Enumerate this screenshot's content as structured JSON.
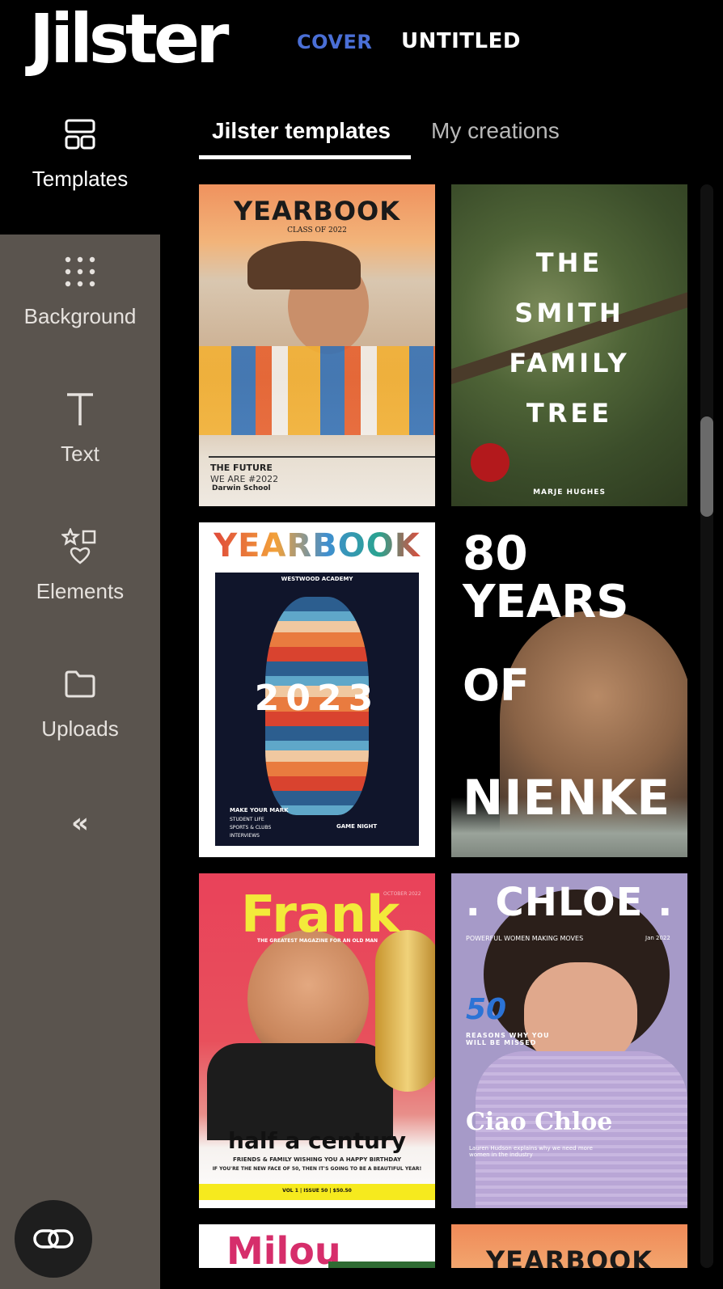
{
  "header": {
    "logo": "Jilster",
    "cover_label": "COVER",
    "document_title": "UNTITLED"
  },
  "sidebar": {
    "items": [
      {
        "label": "Templates",
        "icon": "templates-icon"
      },
      {
        "label": "Background",
        "icon": "dots-grid-icon"
      },
      {
        "label": "Text",
        "icon": "text-icon"
      },
      {
        "label": "Elements",
        "icon": "shapes-icon"
      },
      {
        "label": "Uploads",
        "icon": "folder-icon"
      }
    ],
    "collapse_label": "«",
    "fab_icon": "link-icon"
  },
  "tabs": [
    {
      "label": "Jilster templates",
      "active": true
    },
    {
      "label": "My creations",
      "active": false
    }
  ],
  "templates": [
    {
      "title": "YEARBOOK",
      "subtitle": "CLASS OF 2022",
      "line1": "THE FUTURE",
      "line2": "WE ARE #2022",
      "line3": "Darwin School"
    },
    {
      "line1": "THE",
      "line2": "SMITH",
      "line3": "FAMILY",
      "line4": "TREE",
      "author": "MARJE HUGHES"
    },
    {
      "title": "YEARBOOK",
      "school": "WESTWOOD ACADEMY",
      "year": "2023",
      "left1": "MAKE YOUR MARK",
      "left2": "STUDENT LIFE",
      "left3": "SPORTS & CLUBS",
      "left4": "INTERVIEWS",
      "right1": "GAME NIGHT"
    },
    {
      "line1": "80",
      "line2": "YEARS",
      "line3": "OF",
      "line4": "NIENKE"
    },
    {
      "title": "Frank",
      "date": "OCTOBER 2022",
      "tagline": "THE GREATEST MAGAZINE FOR AN OLD MAN",
      "headline": "half a century",
      "sub1": "FRIENDS & FAMILY WISHING YOU A HAPPY BIRTHDAY",
      "sub2": "IF YOU'RE THE NEW FACE OF 50, THEN IT'S GOING TO BE A BEAUTIFUL YEAR!",
      "footer": "VOL 1 | ISSUE 50 | $50.50"
    },
    {
      "title": ". CHLOE .",
      "tagline": "POWERFUL WOMEN MAKING MOVES",
      "date": "Jan 2022",
      "number": "50",
      "reasons": "REASONS WHY YOU WILL BE MISSED",
      "headline": "Ciao Chloe",
      "sub": "Lauren Hudson explains why we need more women in the industry"
    },
    {
      "title": "Milou"
    },
    {
      "title": "YEARBOOK"
    }
  ]
}
